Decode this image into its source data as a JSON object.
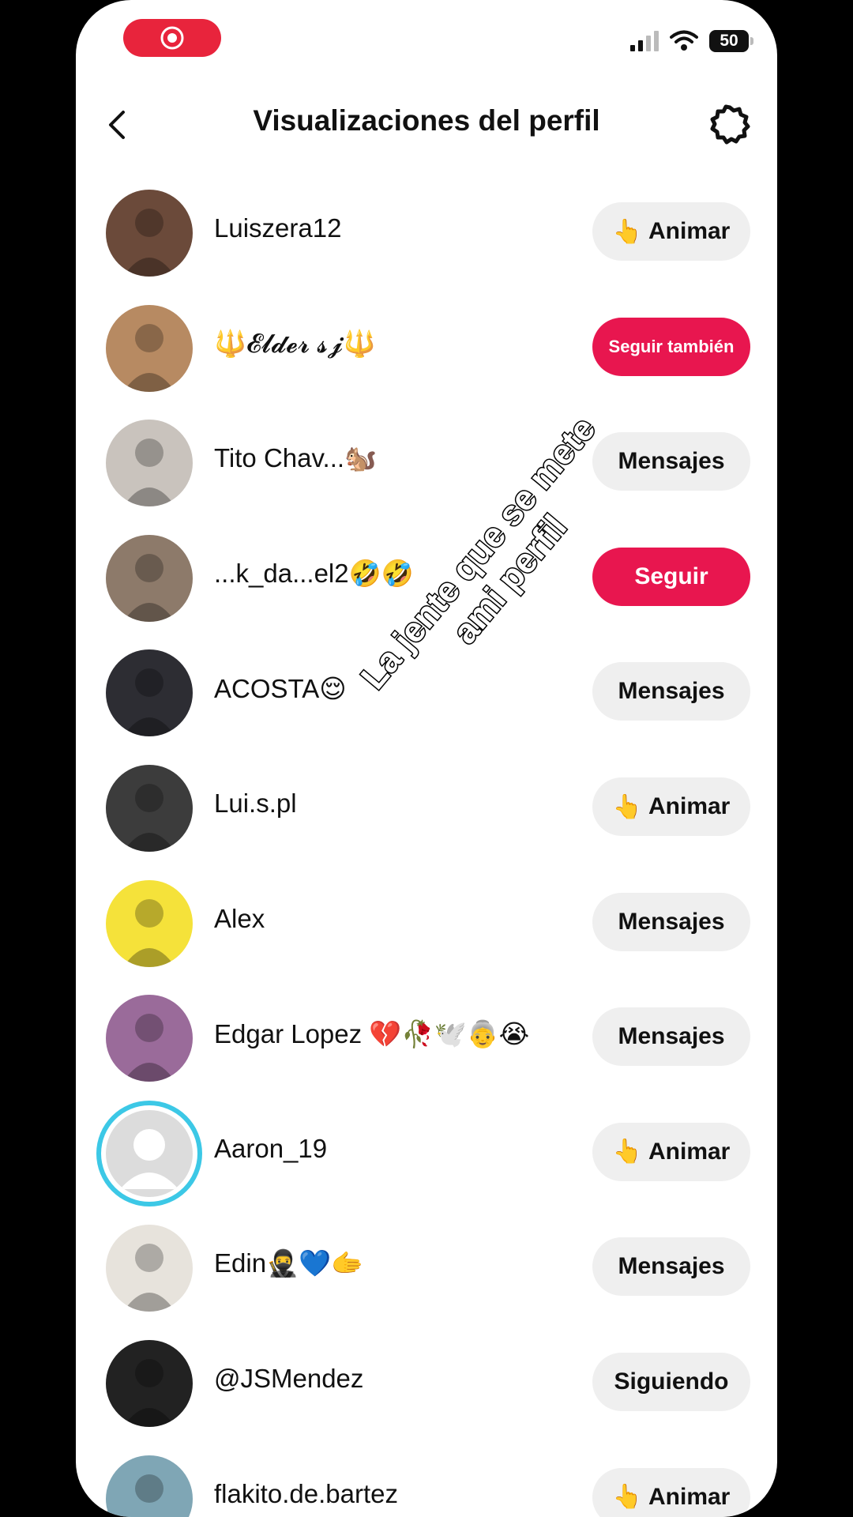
{
  "status": {
    "battery": "50"
  },
  "header": {
    "title": "Visualizaciones del perfil"
  },
  "overlay": {
    "text": "La jente que se mete ami perfil"
  },
  "viewers": [
    {
      "name": "Luiszera12",
      "button": "Animar",
      "button_icon": "👆",
      "style": "gray",
      "avatar_color": "#6b4a3a"
    },
    {
      "name": "🔱𝓔𝓵𝓭𝓮𝓻 𝓼𝓳🔱",
      "button": "Seguir también",
      "style": "red-small",
      "avatar_color": "#b78a62"
    },
    {
      "name": "Tito Chav...🐿️",
      "button": "Mensajes",
      "style": "gray",
      "avatar_color": "#c9c3bd"
    },
    {
      "name": "...k_da...el2🤣🤣",
      "button": "Seguir",
      "style": "red",
      "avatar_color": "#8d7a6a"
    },
    {
      "name": "ACOSTA😌",
      "button": "Mensajes",
      "style": "gray",
      "avatar_color": "#2d2d33"
    },
    {
      "name": "Lui.s.pl",
      "button": "Animar",
      "button_icon": "👆",
      "style": "gray",
      "avatar_color": "#3c3c3c"
    },
    {
      "name": "Alex",
      "button": "Mensajes",
      "style": "gray",
      "avatar_color": "#f5e23a"
    },
    {
      "name": "Edgar Lopez 💔🥀🕊️👵😭",
      "button": "Mensajes",
      "style": "gray",
      "avatar_color": "#9a6b9a"
    },
    {
      "name": "Aaron_19",
      "button": "Animar",
      "button_icon": "👆",
      "style": "gray",
      "avatar_color": "#dcdcdc",
      "default_avatar": true
    },
    {
      "name": "Edin🥷💙🫱",
      "button": "Mensajes",
      "style": "gray",
      "avatar_color": "#e7e3dc"
    },
    {
      "name": "@JSMendez",
      "button": "Siguiendo",
      "style": "gray",
      "avatar_color": "#222222"
    },
    {
      "name": "flakito.de.bartez",
      "button": "Animar",
      "button_icon": "👆",
      "style": "gray",
      "avatar_color": "#7fa6b5"
    }
  ]
}
